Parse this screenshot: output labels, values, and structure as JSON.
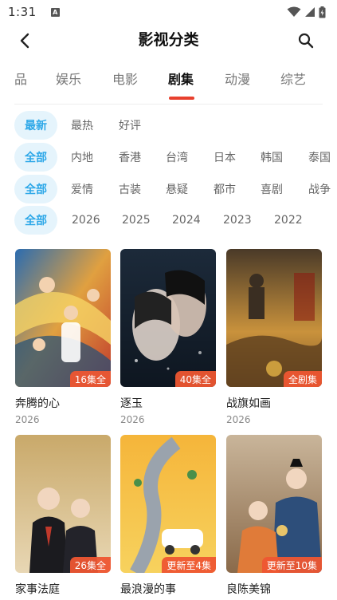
{
  "status": {
    "time": "1:31",
    "notice_glyph": "A"
  },
  "header": {
    "title": "影视分类"
  },
  "tabs": [
    {
      "label": "品"
    },
    {
      "label": "娱乐"
    },
    {
      "label": "电影"
    },
    {
      "label": "剧集"
    },
    {
      "label": "动漫"
    },
    {
      "label": "综艺"
    }
  ],
  "active_tab": "剧集",
  "filters": {
    "sort": [
      "最新",
      "最热",
      "好评"
    ],
    "region": [
      "全部",
      "内地",
      "香港",
      "台湾",
      "日本",
      "韩国",
      "泰国"
    ],
    "genre": [
      "全部",
      "爱情",
      "古装",
      "悬疑",
      "都市",
      "喜剧",
      "战争"
    ],
    "year": [
      "全部",
      "2026",
      "2025",
      "2024",
      "2023",
      "2022"
    ]
  },
  "colors": {
    "accent": "#2ea8e8",
    "accent_bg": "#e5f4fc",
    "badge": "#ee5632",
    "indicator": "#e8402e"
  },
  "shows": [
    {
      "title": "奔腾的心",
      "year": "2026",
      "badge": "16集全"
    },
    {
      "title": "逐玉",
      "year": "2026",
      "badge": "40集全"
    },
    {
      "title": "战旗如画",
      "year": "2026",
      "badge": "全剧集"
    },
    {
      "title": "家事法庭",
      "year": "",
      "badge": "26集全"
    },
    {
      "title": "最浪漫的事",
      "year": "",
      "badge": "更新至4集"
    },
    {
      "title": "良陈美锦",
      "year": "",
      "badge": "更新至10集"
    }
  ]
}
